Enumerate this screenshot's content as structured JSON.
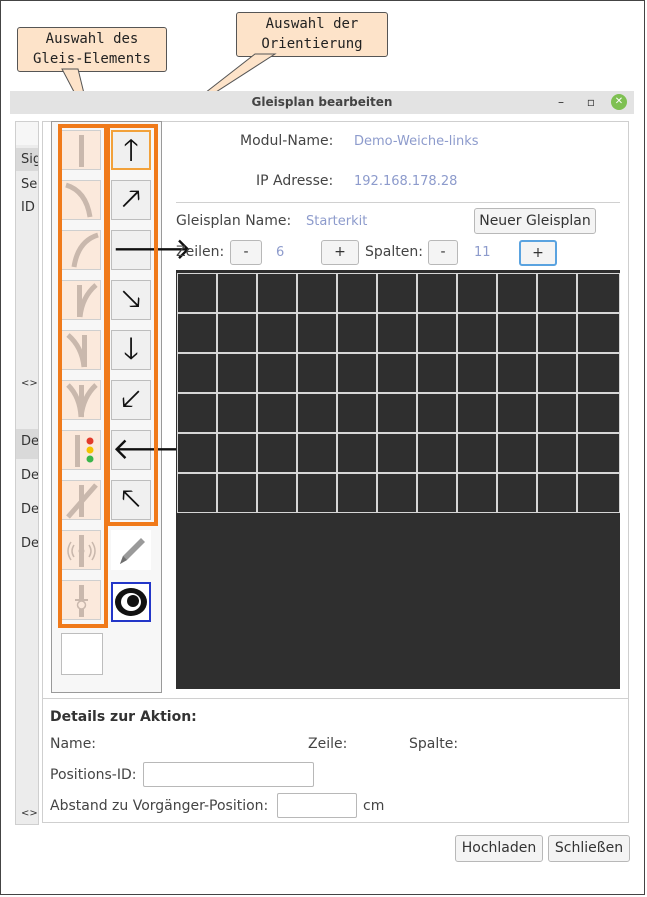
{
  "callouts": {
    "element": "Auswahl des\nGleis-Elements",
    "orientation": "Auswahl der\nOrientierung"
  },
  "window": {
    "title": "Gleisplan bearbeiten",
    "minimize": "–",
    "maximize": "▫",
    "close": "✕"
  },
  "left_pane": {
    "rows_top": [
      "Sig",
      "Se",
      "ID"
    ],
    "arrows": "<>",
    "rows_bottom": [
      "De",
      "De",
      "De",
      "De"
    ],
    "arrows_bottom": "<>"
  },
  "module": {
    "name_label": "Modul-Name:",
    "name_value": "Demo-Weiche-links",
    "ip_label": "IP Adresse:",
    "ip_value": "192.168.178.28"
  },
  "plan": {
    "name_label": "Gleisplan Name:",
    "name_value": "Starterkit",
    "new_button": "Neuer Gleisplan",
    "rows_label": "Zeilen:",
    "rows_minus": "-",
    "rows_value": "6",
    "rows_plus": "+",
    "cols_label": "Spalten:",
    "cols_minus": "-",
    "cols_value": "11",
    "cols_plus": "+"
  },
  "grid": {
    "rows": 6,
    "cols": 11
  },
  "palette": {
    "elements": [
      "straight-track-icon",
      "curve-left-track-icon",
      "curve-right-track-icon",
      "switch-right-track-icon",
      "switch-left-track-icon",
      "switch-three-way-icon",
      "signal-icon",
      "crossing-track-icon",
      "sensor-icon",
      "position-marker-icon",
      "empty-tile"
    ],
    "orientations": [
      {
        "icon": "arrow-up-icon",
        "glyph": "🡑"
      },
      {
        "icon": "arrow-up-right-icon",
        "glyph": "🡕"
      },
      {
        "icon": "arrow-right-icon",
        "glyph": "🡒"
      },
      {
        "icon": "arrow-down-right-icon",
        "glyph": "🡖"
      },
      {
        "icon": "arrow-down-icon",
        "glyph": "🡓"
      },
      {
        "icon": "arrow-down-left-icon",
        "glyph": "🡗"
      },
      {
        "icon": "arrow-left-icon",
        "glyph": "🡐"
      },
      {
        "icon": "arrow-up-left-icon",
        "glyph": "🡔"
      }
    ],
    "tools": [
      "pencil-icon",
      "eye-icon"
    ]
  },
  "details": {
    "heading": "Details zur Aktion:",
    "name_label": "Name:",
    "row_label": "Zeile:",
    "col_label": "Spalte:",
    "pos_id_label": "Positions-ID:",
    "pos_id_value": "",
    "distance_label": "Abstand zu Vorgänger-Position:",
    "distance_value": "",
    "unit": "cm"
  },
  "footer": {
    "upload": "Hochladen",
    "close": "Schließen"
  },
  "colors": {
    "highlight": "#f07a1a",
    "callout_bg": "#fde3c9",
    "grid_bg": "#2f2f2f",
    "value_text": "#8d9bcc"
  }
}
